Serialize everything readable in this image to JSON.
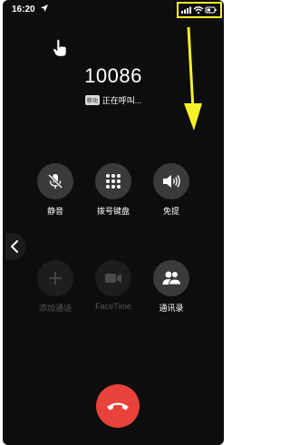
{
  "status_bar": {
    "time": "16:20",
    "icons": [
      "location-arrow-icon",
      "signal-icon",
      "wifi-icon",
      "battery-icon"
    ]
  },
  "annotation": {
    "highlight_color": "#f7f228"
  },
  "call": {
    "number": "10086",
    "sim_badge": "移动",
    "status": "正在呼叫..."
  },
  "controls": [
    {
      "label": "静音",
      "icon": "mic-off-icon",
      "enabled": true
    },
    {
      "label": "拨号键盘",
      "icon": "keypad-icon",
      "enabled": true
    },
    {
      "label": "免提",
      "icon": "speaker-icon",
      "enabled": true
    },
    {
      "label": "添加通话",
      "icon": "plus-icon",
      "enabled": false
    },
    {
      "label": "FaceTime",
      "icon": "video-icon",
      "enabled": false
    },
    {
      "label": "通讯录",
      "icon": "contacts-icon",
      "enabled": true
    }
  ],
  "end_call": {
    "icon": "hang-up-icon",
    "color": "#e8423a"
  }
}
